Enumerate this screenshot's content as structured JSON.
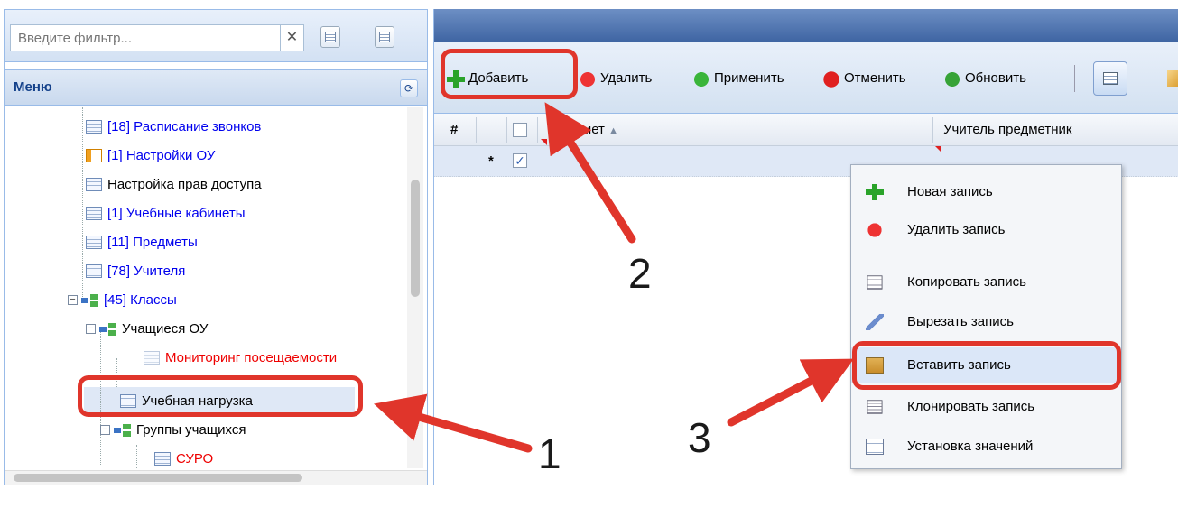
{
  "filter": {
    "placeholder": "Введите фильтр..."
  },
  "menu": {
    "title": "Меню"
  },
  "tree": {
    "items": [
      {
        "label": "[18] Расписание звонков",
        "color": "blue"
      },
      {
        "label": "[1] Настройки ОУ",
        "color": "blue"
      },
      {
        "label": "Настройка прав доступа",
        "color": "black"
      },
      {
        "label": "[1] Учебные кабинеты",
        "color": "blue"
      },
      {
        "label": "[11] Предметы",
        "color": "blue"
      },
      {
        "label": "[78] Учителя",
        "color": "blue"
      },
      {
        "label": "[45] Классы",
        "color": "blue"
      },
      {
        "label": "Учащиеся ОУ",
        "color": "black"
      },
      {
        "label": "Мониторинг посещаемости",
        "color": "red"
      },
      {
        "label": "Учебная нагрузка",
        "color": "black"
      },
      {
        "label": "Группы учащихся",
        "color": "black"
      },
      {
        "label": "СУРО",
        "color": "red"
      }
    ]
  },
  "toolbar": {
    "add": "Добавить",
    "delete": "Удалить",
    "apply": "Применить",
    "cancel": "Отменить",
    "refresh": "Обновить"
  },
  "grid": {
    "columns": {
      "num": "#",
      "subject": "Предмет",
      "teacher": "Учитель предметник"
    },
    "row": {
      "marker": "*"
    }
  },
  "context_menu": {
    "items": [
      {
        "label": "Новая запись"
      },
      {
        "label": "Удалить запись"
      },
      {
        "label": "Копировать запись"
      },
      {
        "label": "Вырезать запись"
      },
      {
        "label": "Вставить запись"
      },
      {
        "label": "Клонировать запись"
      },
      {
        "label": "Установка значений"
      }
    ]
  },
  "annotations": {
    "step1": "1",
    "step2": "2",
    "step3": "3"
  },
  "colors": {
    "highlight": "#e0352b",
    "header_dark": "#3f65a3",
    "selection": "#dfe8f6"
  }
}
